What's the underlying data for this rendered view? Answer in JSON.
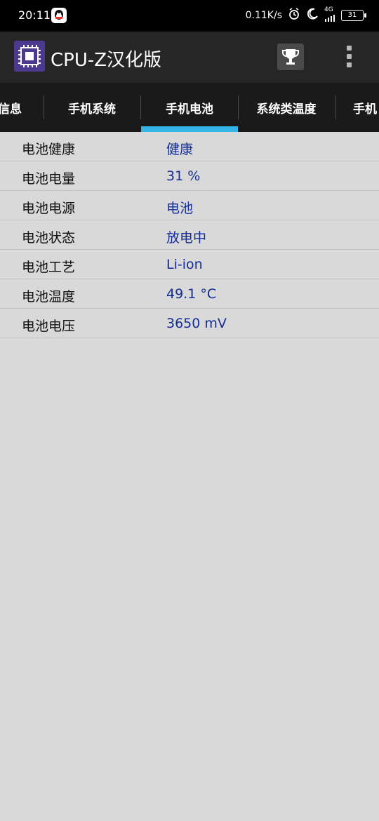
{
  "status_bar": {
    "time": "20:11",
    "speed": "0.11K/s",
    "network": "4G",
    "battery": "31"
  },
  "app_bar": {
    "title": "CPU-Z汉化版",
    "icons": [
      "cpu-logo-icon",
      "trophy-icon",
      "more-vert-icon"
    ]
  },
  "tabs": [
    {
      "label": "信息"
    },
    {
      "label": "手机系统"
    },
    {
      "label": "手机电池"
    },
    {
      "label": "系统类温度"
    },
    {
      "label": "手机"
    }
  ],
  "battery_info": {
    "rows": [
      {
        "label": "电池健康",
        "value": "健康"
      },
      {
        "label": "电池电量",
        "value": "31 %"
      },
      {
        "label": "电池电源",
        "value": "电池"
      },
      {
        "label": "电池状态",
        "value": "放电中"
      },
      {
        "label": "电池工艺",
        "value": "Li-ion"
      },
      {
        "label": "电池温度",
        "value": "49.1 °C"
      },
      {
        "label": "电池电压",
        "value": "3650 mV"
      }
    ]
  },
  "colors": {
    "accent": "#33b5e5",
    "value_text": "#142d96",
    "app_bar": "#262626",
    "tab_bar": "#1a1a1a",
    "background": "#d9d9d9"
  }
}
